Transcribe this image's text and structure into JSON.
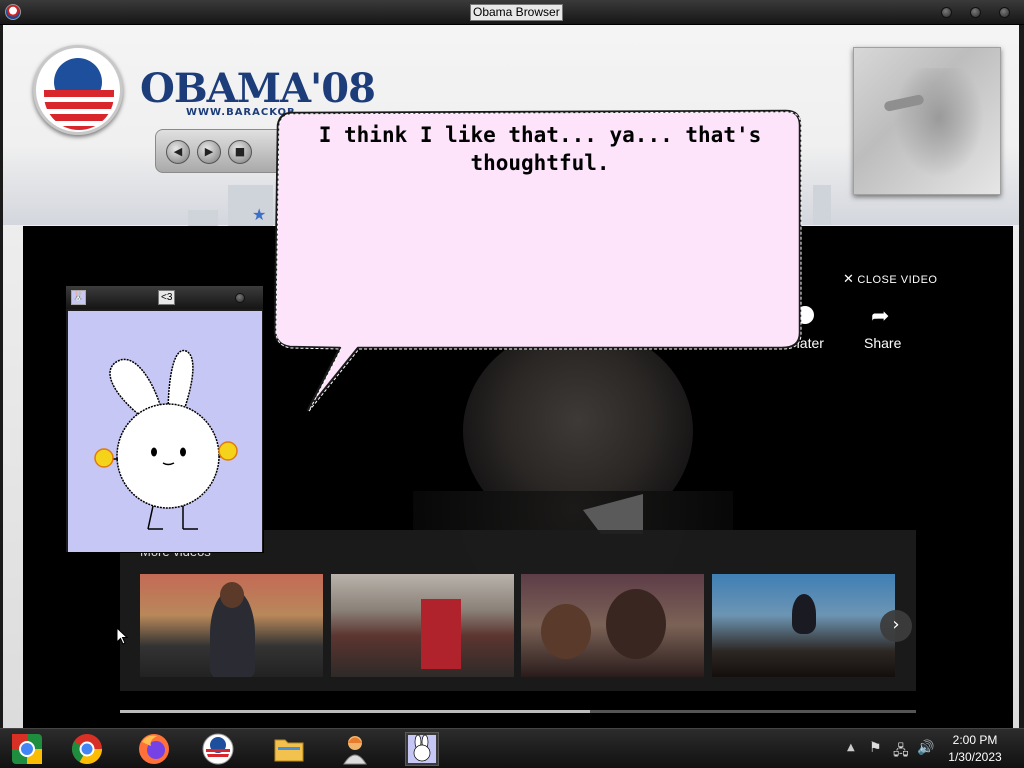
{
  "window": {
    "title": "Obama Browser"
  },
  "site": {
    "wordmark": "OBAMA'08",
    "url_text": "WWW.BARACKOB"
  },
  "video": {
    "close_label": "CLOSE VIDEO",
    "watch_later_label": "ch later",
    "share_label": "Share",
    "more_videos_label": "More videos",
    "progress_fraction": 0.0,
    "buffer_fraction": 0.59
  },
  "companion": {
    "title_label": "<3"
  },
  "speech": {
    "text": "I think I like that... ya... that's thoughtful."
  },
  "taskbar": {
    "apps": [
      "chrome-logo-icon",
      "chrome-icon",
      "firefox-icon",
      "obama-browser-icon",
      "file-explorer-icon",
      "user-agent-icon",
      "bunny-companion-icon"
    ],
    "clock_time": "2:00 PM",
    "clock_date": "1/30/2023"
  },
  "colors": {
    "bubble_fill": "#fde4fb",
    "bunny_bg": "#c7c7f5",
    "obama_blue": "#1d3d7a",
    "obama_red": "#d9262c"
  }
}
